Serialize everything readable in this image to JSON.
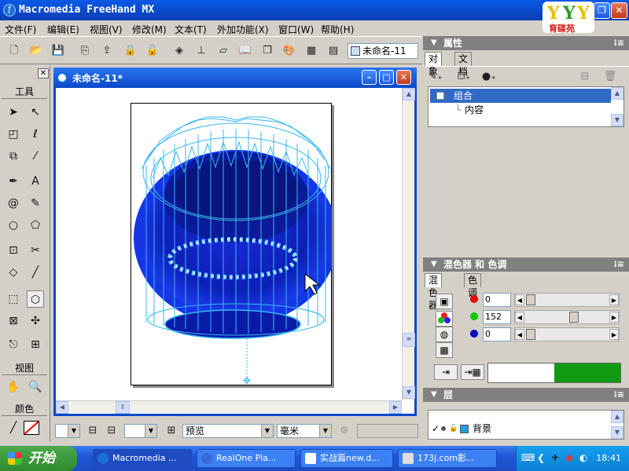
{
  "window": {
    "title": "Macromedia FreeHand MX",
    "logo_text": "育碟苑"
  },
  "menu": [
    {
      "label": "文件(F)"
    },
    {
      "label": "编辑(E)"
    },
    {
      "label": "视图(V)"
    },
    {
      "label": "修改(M)"
    },
    {
      "label": "文本(T)"
    },
    {
      "label": "外加功能(X)"
    },
    {
      "label": "窗口(W)"
    },
    {
      "label": "帮助(H)"
    }
  ],
  "toolbar": {
    "doc_selector": "未命名-11"
  },
  "tools": {
    "title": "工具",
    "view_title": "视图",
    "color_title": "颜色"
  },
  "document": {
    "title": "未命名-11*"
  },
  "statusbar": {
    "zoom": "",
    "page_num": "",
    "view_mode": "预览",
    "units": "毫米"
  },
  "properties": {
    "title": "属性",
    "tab_object": "对象",
    "tab_document": "文档",
    "tree": {
      "group": "组合",
      "contents": "内容"
    }
  },
  "mixer": {
    "title": "混色器 和 色调",
    "tab_mixer": "混色器",
    "tab_tint": "色调",
    "r": "0",
    "g": "152",
    "b": "0",
    "g_level": 0.6,
    "swatch_color": "#129a12"
  },
  "layers": {
    "title": "层",
    "layer_name": "背景",
    "layer_color": "#1ea0d8"
  },
  "taskbar": {
    "start": "开始",
    "tasks": [
      {
        "label": "Macromedia ..."
      },
      {
        "label": "RealOne Pla..."
      },
      {
        "label": "实战篇new.d..."
      },
      {
        "label": "173j.com影..."
      }
    ],
    "clock": "18:41"
  }
}
